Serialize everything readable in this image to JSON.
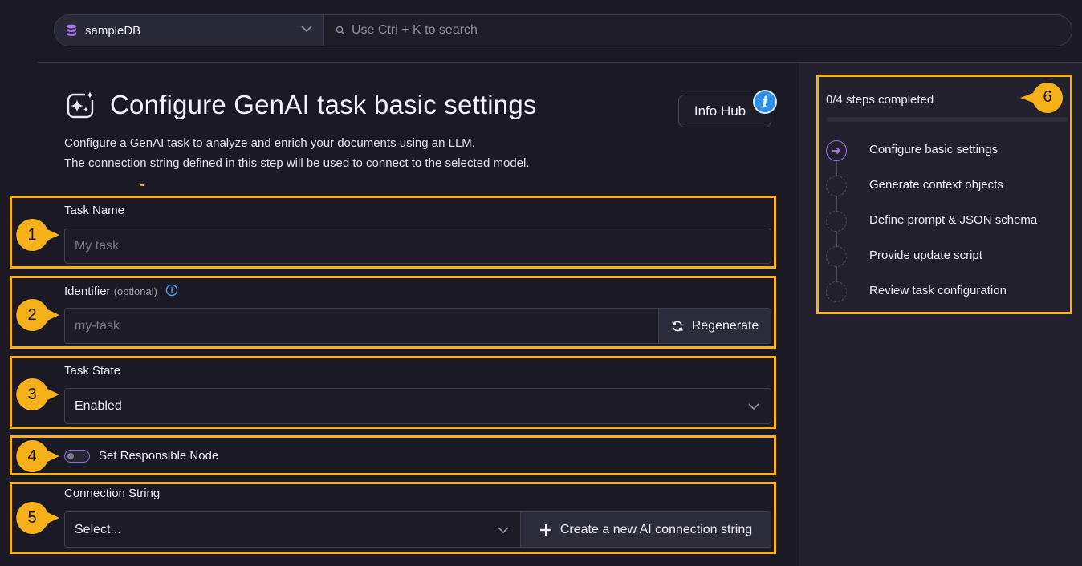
{
  "topbar": {
    "database_name": "sampleDB",
    "search_placeholder": "Use Ctrl + K to search"
  },
  "header": {
    "title": "Configure GenAI task basic settings",
    "info_hub_label": "Info Hub",
    "info_badge_glyph": "i",
    "description_line1": "Configure a GenAI task to analyze and enrich your documents using an LLM.",
    "description_line2": "The connection string defined in this step will be used to connect to the selected model."
  },
  "form": {
    "task_name": {
      "label": "Task Name",
      "placeholder": "My task",
      "callout": "1"
    },
    "identifier": {
      "label": "Identifier",
      "optional_label": "(optional)",
      "placeholder": "my-task",
      "regenerate_label": "Regenerate",
      "callout": "2"
    },
    "task_state": {
      "label": "Task State",
      "value": "Enabled",
      "callout": "3"
    },
    "responsible_node": {
      "label": "Set Responsible Node",
      "toggled": false,
      "callout": "4"
    },
    "connection_string": {
      "label": "Connection String",
      "value": "Select...",
      "create_label": "Create a new AI connection string",
      "callout": "5"
    }
  },
  "steps": {
    "progress_text": "0/4 steps completed",
    "callout": "6",
    "items": [
      {
        "label": "Configure basic settings",
        "state": "active"
      },
      {
        "label": "Generate context objects",
        "state": "pending"
      },
      {
        "label": "Define prompt & JSON schema",
        "state": "pending"
      },
      {
        "label": "Provide update script",
        "state": "pending"
      },
      {
        "label": "Review task configuration",
        "state": "pending"
      }
    ]
  },
  "colors": {
    "callout": "#f5b01a",
    "accent_purple": "#9b6ee0",
    "info_blue": "#2f8fe6",
    "background": "#1b1a24"
  }
}
